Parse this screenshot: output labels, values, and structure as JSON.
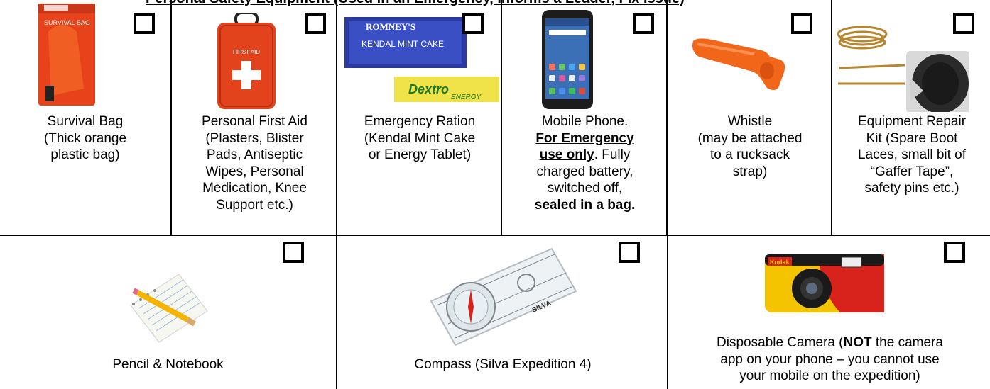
{
  "header": {
    "title": "Personal Safety Equipment (Used in an Emergency, Informs a Leader, Fix Issue)"
  },
  "row1": [
    {
      "id": "survival-bag",
      "lines": [
        "Survival Bag",
        "(Thick orange",
        "plastic bag)"
      ],
      "pack_text": "SURVIVAL BAG"
    },
    {
      "id": "first-aid",
      "lines": [
        "Personal First Aid",
        "(Plasters, Blister",
        "Pads, Antiseptic",
        "Wipes, Personal",
        "Medication, Knee",
        "Support etc.)"
      ],
      "pack_text": "FIRST AID"
    },
    {
      "id": "ration",
      "lines": [
        "Emergency Ration",
        "(Kendal Mint Cake",
        "or Energy Tablet)"
      ],
      "brand1": "ROMNEY'S",
      "brand2": "KENDAL MINT CAKE",
      "brand3": "Dextro",
      "brand4": "ENERGY"
    },
    {
      "id": "phone",
      "line1": "Mobile Phone.",
      "emph1": "For Emergency",
      "emph2": "use only",
      "rest2": ". Fully",
      "line4": "charged battery,",
      "line5": "switched off,",
      "emph3": "sealed in a bag."
    },
    {
      "id": "whistle",
      "lines": [
        "Whistle",
        "(may be attached",
        "to a rucksack",
        "strap)"
      ]
    },
    {
      "id": "repair-kit",
      "lines": [
        "Equipment Repair",
        "Kit (Spare Boot",
        "Laces, small bit of",
        "“Gaffer Tape”,",
        "safety pins etc.)"
      ]
    }
  ],
  "row2": [
    {
      "id": "notebook",
      "label": "Pencil & Notebook"
    },
    {
      "id": "compass",
      "label": "Compass (Silva Expedition 4)",
      "brand": "SILVA"
    },
    {
      "id": "camera",
      "pre": "Disposable Camera (",
      "bold": "NOT",
      "post": " the camera",
      "line2": "app on your phone – you cannot use",
      "line3": "your mobile on the expedition)",
      "brand": "Kodak"
    }
  ],
  "colors": {
    "orange": "#f26a1b",
    "red_bag": "#e8421a",
    "camera_yellow": "#f5c400",
    "camera_red": "#d8231c"
  }
}
